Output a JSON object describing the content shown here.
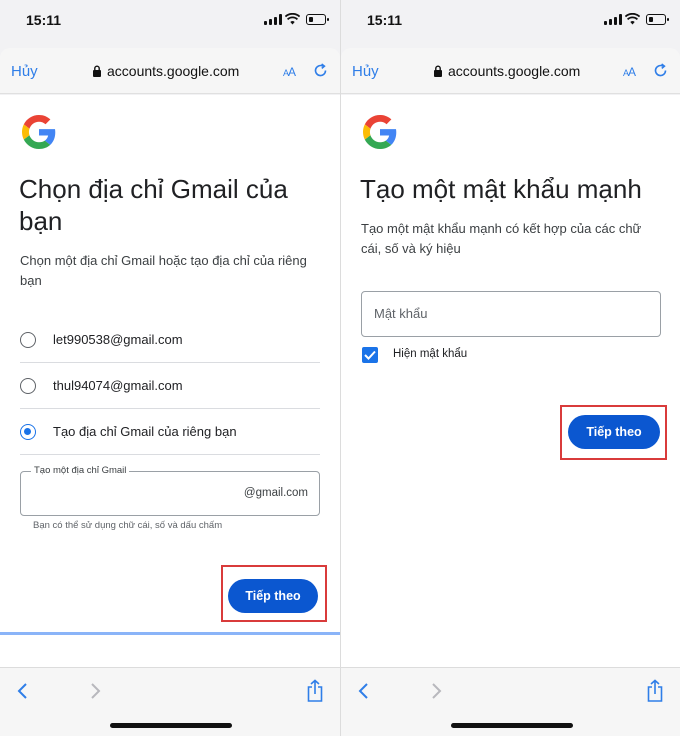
{
  "status": {
    "time": "15:11"
  },
  "browser": {
    "cancel": "Hủy",
    "url": "accounts.google.com",
    "text_size_a": "A",
    "text_size_b": "A"
  },
  "left": {
    "title": "Chọn địa chỉ Gmail của bạn",
    "description": "Chọn một địa chỉ Gmail hoặc tạo địa chỉ của riêng bạn",
    "options": [
      {
        "label": "let990538@gmail.com",
        "selected": false
      },
      {
        "label": "thul94074@gmail.com",
        "selected": false
      },
      {
        "label": "Tạo địa chỉ Gmail của riêng bạn",
        "selected": true
      }
    ],
    "gmail_field": {
      "label": "Tạo một địa chỉ Gmail",
      "value": "",
      "suffix": "@gmail.com"
    },
    "hint": "Bạn có thể sử dụng chữ cái, số và dấu chấm",
    "next_button": "Tiếp theo"
  },
  "right": {
    "title": "Tạo một mật khẩu mạnh",
    "description": "Tạo một mật khẩu mạnh có kết hợp của các chữ cái, số và ký hiệu",
    "password_field": {
      "placeholder": "Mật khẩu",
      "value": ""
    },
    "show_password": {
      "label": "Hiện mật khẩu",
      "checked": true
    },
    "next_button": "Tiếp theo"
  },
  "colors": {
    "accent": "#0b57d0",
    "link": "#2f7ee8",
    "highlight": "#d93b3b",
    "progress": "#8ab4f8"
  },
  "icons": [
    "lock-icon",
    "reload-icon",
    "google-logo",
    "back-arrow-icon",
    "forward-arrow-icon",
    "share-icon",
    "checkmark-icon",
    "wifi-icon",
    "signal-icon",
    "battery-icon"
  ]
}
